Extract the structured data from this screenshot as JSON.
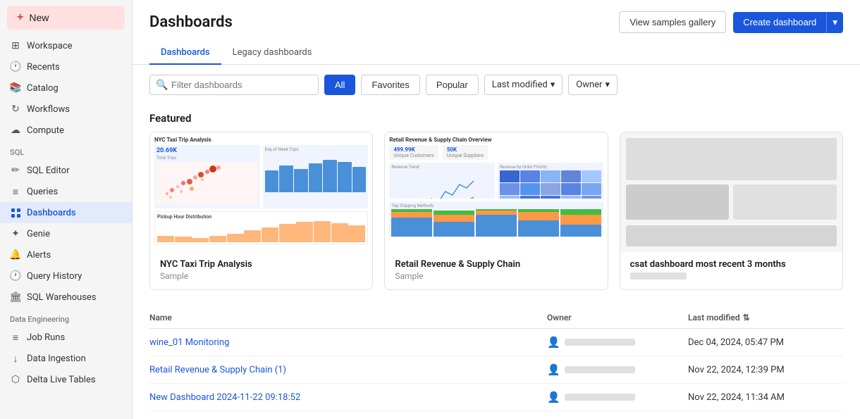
{
  "sidebar": {
    "new_label": "New",
    "items": [
      {
        "id": "workspace",
        "label": "Workspace",
        "icon": "⊞"
      },
      {
        "id": "recents",
        "label": "Recents",
        "icon": "🕐"
      },
      {
        "id": "catalog",
        "label": "Catalog",
        "icon": "📚"
      },
      {
        "id": "workflows",
        "label": "Workflows",
        "icon": "↻"
      },
      {
        "id": "compute",
        "label": "Compute",
        "icon": "☁"
      }
    ],
    "sql_section": "SQL",
    "sql_items": [
      {
        "id": "sql-editor",
        "label": "SQL Editor",
        "icon": "✏"
      },
      {
        "id": "queries",
        "label": "Queries",
        "icon": "≡"
      },
      {
        "id": "dashboards",
        "label": "Dashboards",
        "icon": "⊞",
        "active": true
      },
      {
        "id": "genie",
        "label": "Genie",
        "icon": "✦"
      },
      {
        "id": "alerts",
        "label": "Alerts",
        "icon": "🔔"
      },
      {
        "id": "query-history",
        "label": "Query History",
        "icon": "🕐"
      },
      {
        "id": "sql-warehouses",
        "label": "SQL Warehouses",
        "icon": "🏛"
      }
    ],
    "data_eng_section": "Data Engineering",
    "data_eng_items": [
      {
        "id": "job-runs",
        "label": "Job Runs",
        "icon": "≡"
      },
      {
        "id": "data-ingestion",
        "label": "Data Ingestion",
        "icon": "↓"
      },
      {
        "id": "delta-live-tables",
        "label": "Delta Live Tables",
        "icon": "⬡"
      }
    ]
  },
  "header": {
    "title": "Dashboards",
    "view_samples_label": "View samples gallery",
    "create_dashboard_label": "Create dashboard"
  },
  "tabs": [
    {
      "id": "dashboards",
      "label": "Dashboards",
      "active": true
    },
    {
      "id": "legacy",
      "label": "Legacy dashboards",
      "active": false
    }
  ],
  "filters": {
    "search_placeholder": "Filter dashboards",
    "all_label": "All",
    "favorites_label": "Favorites",
    "popular_label": "Popular",
    "last_modified_label": "Last modified",
    "owner_label": "Owner"
  },
  "featured": {
    "section_title": "Featured",
    "cards": [
      {
        "id": "nyc-taxi",
        "title": "NYC Taxi Trip Analysis",
        "subtitle": "Sample"
      },
      {
        "id": "retail-revenue",
        "title": "Retail Revenue & Supply Chain",
        "subtitle": "Sample"
      },
      {
        "id": "csat-dashboard",
        "title": "csat dashboard most recent 3 months",
        "subtitle": ""
      }
    ]
  },
  "table": {
    "columns": {
      "name": "Name",
      "owner": "Owner",
      "last_modified": "Last modified"
    },
    "rows": [
      {
        "name": "wine_01 Monitoring",
        "owner_placeholder": true,
        "last_modified": "Dec 04, 2024, 05:47 PM"
      },
      {
        "name": "Retail Revenue & Supply Chain (1)",
        "owner_placeholder": true,
        "last_modified": "Nov 22, 2024, 12:39 PM"
      },
      {
        "name": "New Dashboard 2024-11-22 09:18:52",
        "owner_placeholder": true,
        "last_modified": "Nov 22, 2024, 11:34 AM"
      }
    ]
  }
}
